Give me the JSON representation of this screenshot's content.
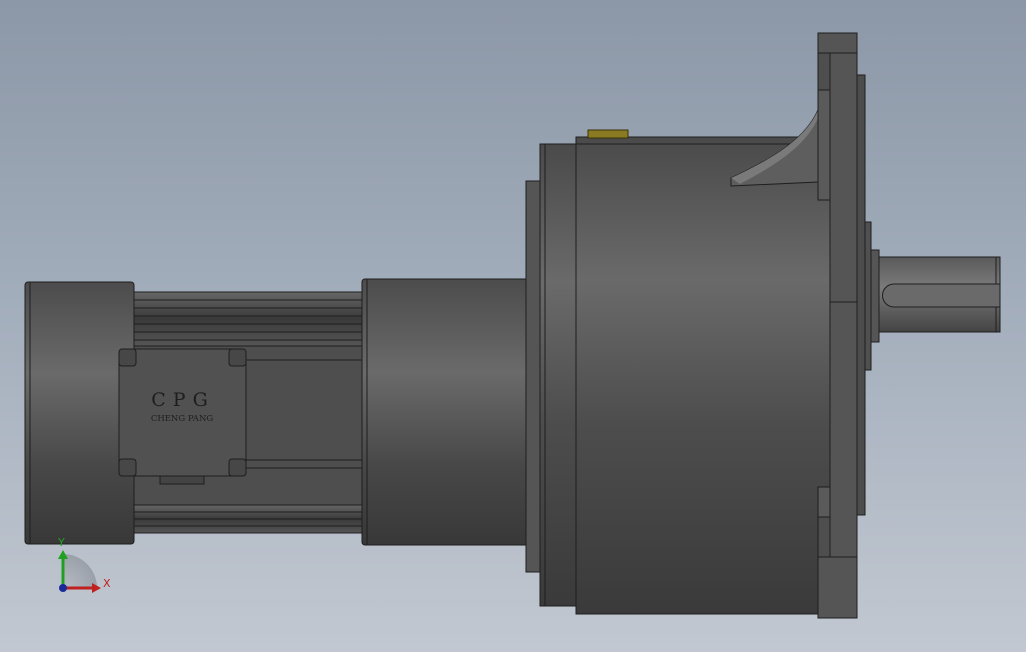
{
  "viewport": {
    "background_top": "#8c97a7",
    "background_bottom": "#c2c8d1"
  },
  "model": {
    "body_color": "#5a5a5a",
    "edge_color": "#1e1e1e",
    "nameplate": {
      "brand": "CPG",
      "company": "CHENG PANG"
    },
    "terminal_color": "#8a7a22"
  },
  "triad": {
    "x_label": "X",
    "y_label": "Y",
    "x_color": "#c02020",
    "y_color": "#20a020",
    "origin_color": "#1a2a9a"
  }
}
